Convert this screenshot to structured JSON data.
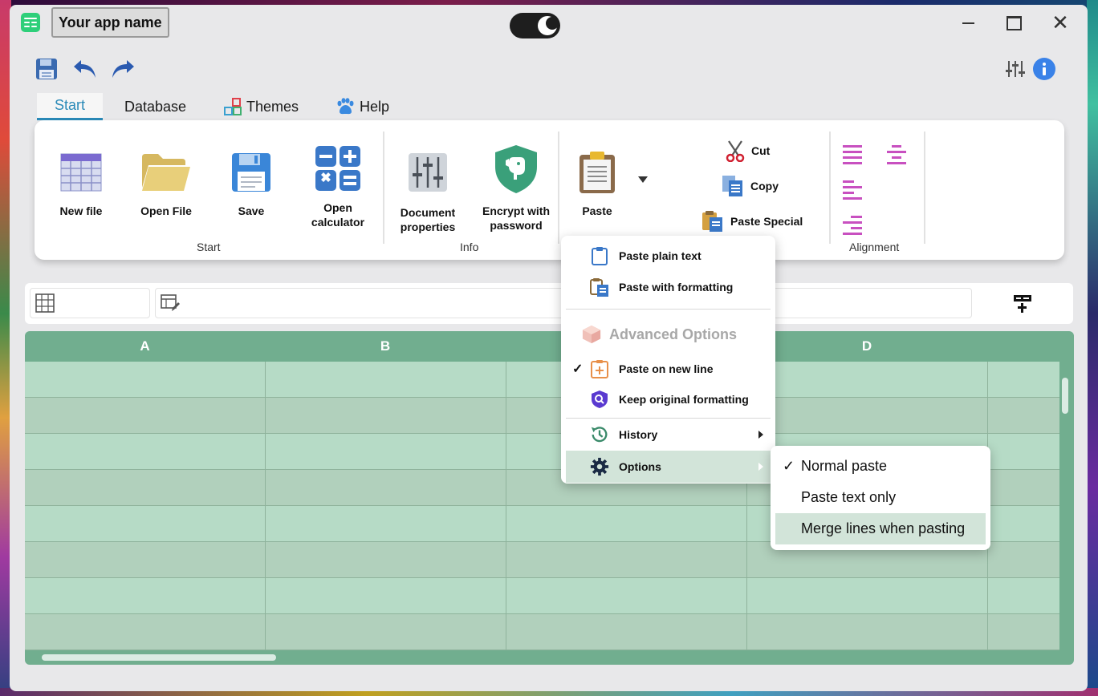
{
  "app": {
    "name": "Your app name"
  },
  "tabs": [
    {
      "label": "Start",
      "active": true
    },
    {
      "label": "Database"
    },
    {
      "label": "Themes",
      "icon": "shapes-icon"
    },
    {
      "label": "Help",
      "icon": "paw-icon"
    }
  ],
  "ribbon": {
    "start": {
      "label": "Start",
      "buttons": [
        {
          "label": "New file",
          "icon": "table-icon"
        },
        {
          "label": "Open File",
          "icon": "folder-icon"
        },
        {
          "label": "Save",
          "icon": "save-icon"
        },
        {
          "label": "Open\ncalculator",
          "icon": "calculator-icon"
        }
      ]
    },
    "info": {
      "label": "Info",
      "buttons": [
        {
          "label": "Document\nproperties",
          "icon": "sliders-icon"
        },
        {
          "label": "Encrypt with\npassword",
          "icon": "shield-dog-icon"
        }
      ]
    },
    "clipboard": {
      "paste": "Paste",
      "cut": "Cut",
      "copy": "Copy",
      "paste_special": "Paste Special"
    },
    "alignment": {
      "label": "Alignment"
    }
  },
  "sheet": {
    "columns": [
      "A",
      "B",
      "",
      "D"
    ]
  },
  "paste_menu": {
    "paste_plain_text": "Paste plain text",
    "paste_with_formatting": "Paste with formatting",
    "advanced_header": "Advanced Options",
    "paste_on_new_line": "Paste on new line",
    "keep_original_formatting": "Keep original formatting",
    "history": "History",
    "options": "Options",
    "check_mark": "✓"
  },
  "options_submenu": {
    "items": [
      "Normal paste",
      "Paste text only",
      "Merge lines when pasting"
    ],
    "checked_index": 0,
    "highlighted_index": 2
  },
  "colors": {
    "accent": "#2a8ab8",
    "sheet_header": "#71ae8f",
    "row_light": "#b6dbc6",
    "row_dark": "#b1d0bc",
    "menu_highlight": "#d2e4d9"
  }
}
